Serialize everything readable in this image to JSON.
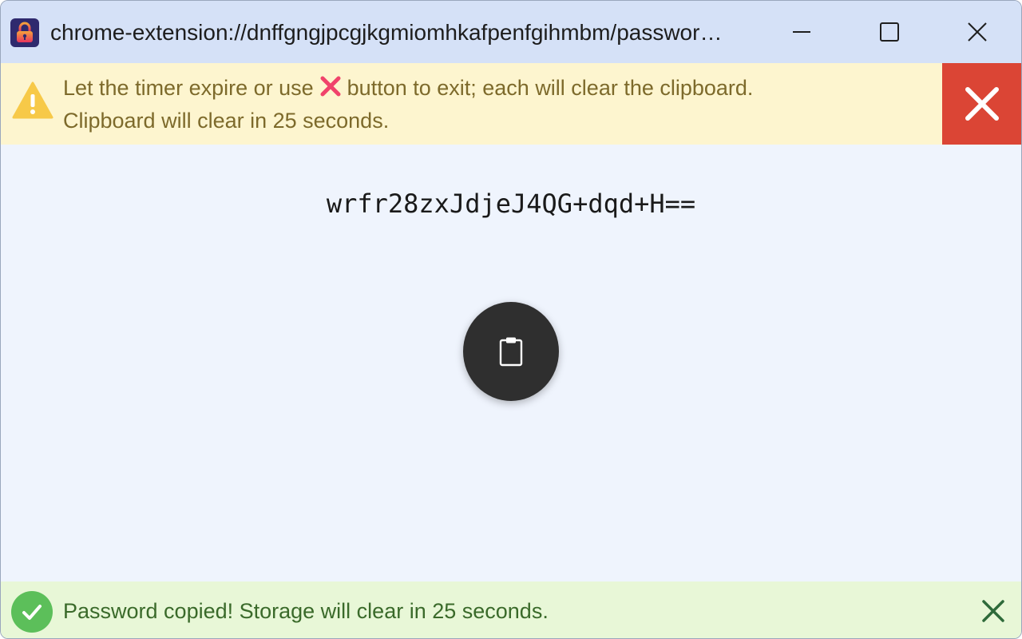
{
  "window": {
    "title": "chrome-extension://dnffgngjpcgjkgmiomhkafpenfgihmbm/passwor…",
    "controls": [
      "minimize",
      "maximize",
      "close"
    ]
  },
  "warning": {
    "line1_before": "Let the timer expire or use",
    "line1_after": "button to exit; each will clear the clipboard.",
    "line2": "Clipboard will clear in 25 seconds.",
    "icons": [
      "warning-icon",
      "cross-mark-icon"
    ]
  },
  "exit_button": {
    "icon": "close-icon",
    "color": "#db4535"
  },
  "password": {
    "value": "wrfr28zxJdjeJ4QG+dqd+H=="
  },
  "copy_button": {
    "icon": "clipboard-icon"
  },
  "status": {
    "message": "Password copied! Storage will clear in 25 seconds.",
    "icon": "check-circle-icon",
    "dismiss_icon": "close-icon"
  },
  "colors": {
    "titlebar": "#d5e1f7",
    "warning_bg": "#fdf5cf",
    "warning_text": "#7d6a2b",
    "exit_red": "#db4535",
    "status_bg": "#e8f7d7",
    "status_text": "#3a6a2a",
    "success_green": "#5cbf5a"
  }
}
